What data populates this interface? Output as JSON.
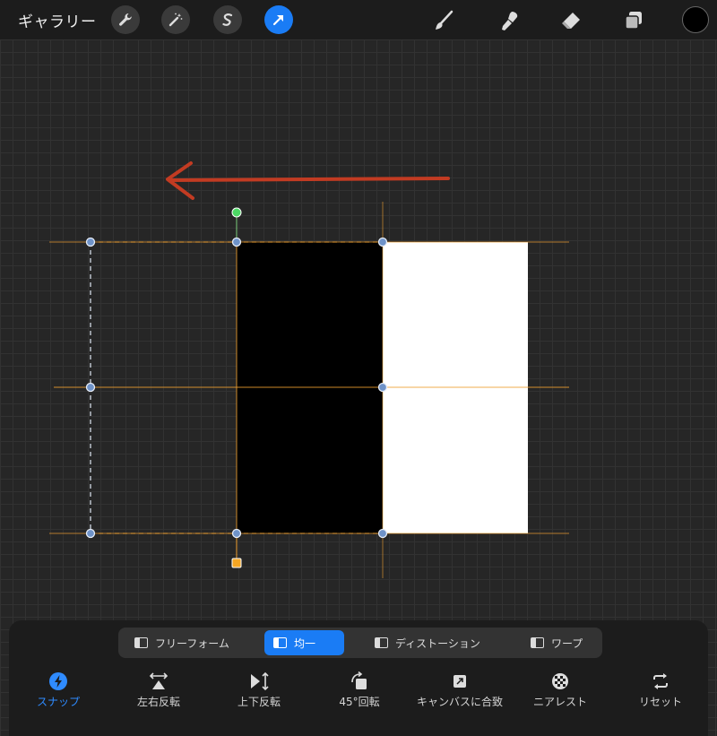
{
  "topbar": {
    "gallery_label": "ギャラリー",
    "tools_left": [
      "wrench-icon",
      "magic-wand-icon",
      "selection-s-icon",
      "transform-arrow-icon"
    ],
    "tools_right": [
      "brush-icon",
      "smudge-icon",
      "eraser-icon",
      "layers-icon"
    ],
    "current_color": "#000000"
  },
  "canvas": {
    "arrow_color": "#c23b22",
    "accent_color": "#f0a030"
  },
  "modes": [
    {
      "label": "フリーフォーム"
    },
    {
      "label": "均一"
    },
    {
      "label": "ディストーション"
    },
    {
      "label": "ワープ"
    }
  ],
  "active_mode": "均一",
  "actions": [
    {
      "label": "スナップ"
    },
    {
      "label": "左右反転"
    },
    {
      "label": "上下反転"
    },
    {
      "label": "45°回転"
    },
    {
      "label": "キャンバスに合致"
    },
    {
      "label": "ニアレスト"
    },
    {
      "label": "リセット"
    }
  ],
  "colors": {
    "accent_blue": "#1a7cf5",
    "guide_orange": "#f0a030"
  }
}
